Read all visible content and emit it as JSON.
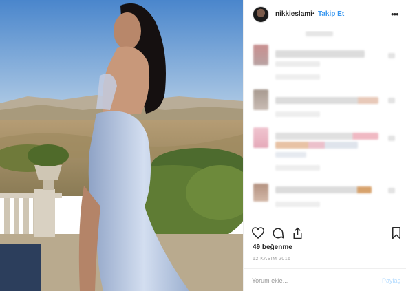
{
  "post": {
    "username": "nikkieslami",
    "separator": "•",
    "follow_label": "Takip Et",
    "more_icon": "ellipsis-icon",
    "likes": "49 beğenme",
    "date": "12 KASIM 2016"
  },
  "actions": {
    "like_icon": "heart-icon",
    "comment_icon": "comment-icon",
    "share_icon": "share-icon",
    "save_icon": "bookmark-icon"
  },
  "comment_box": {
    "placeholder": "Yorum ekle...",
    "post_label": "Paylaş"
  },
  "colors": {
    "link": "#3897f0",
    "post_disabled": "#b3dbff",
    "border": "#efefef",
    "muted": "#999999"
  }
}
